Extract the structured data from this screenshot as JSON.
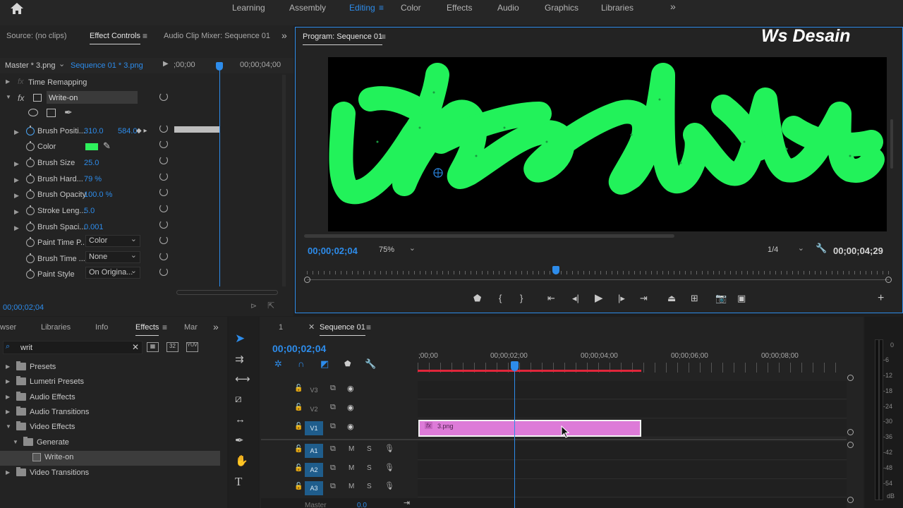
{
  "topbar": {
    "workspaces": [
      "Learning",
      "Assembly",
      "Editing",
      "Color",
      "Effects",
      "Audio",
      "Graphics",
      "Libraries"
    ],
    "active_workspace": "Editing",
    "more": "»"
  },
  "source_panel": {
    "tabs": [
      "Source: (no clips)",
      "Effect Controls",
      "Audio Clip Mixer: Sequence 01"
    ],
    "active_tab": "Effect Controls",
    "master_label": "Master * 3.png",
    "sequence_label": "Sequence 01 * 3.png",
    "ruler_start": ";00;00",
    "ruler_end": "00;00;04;00",
    "time_remapping": "Time Remapping",
    "effect_name": "Write-on",
    "fx_badge": "fx",
    "params": [
      {
        "name": "Brush Positi...",
        "value": "310.0",
        "value2": "584.0"
      },
      {
        "name": "Color",
        "value": ""
      },
      {
        "name": "Brush Size",
        "value": "25.0"
      },
      {
        "name": "Brush Hard...",
        "value": "79 %"
      },
      {
        "name": "Brush Opacity",
        "value": "100.0 %"
      },
      {
        "name": "Stroke Leng...",
        "value": "5.0"
      },
      {
        "name": "Brush Spaci...",
        "value": "0.001"
      },
      {
        "name": "Paint Time P...",
        "value": "Color"
      },
      {
        "name": "Brush Time ...",
        "value": "None"
      },
      {
        "name": "Paint Style",
        "value": "On Origina..."
      }
    ],
    "color_swatch": "#2ef05c",
    "timecode": "00;00;02;04"
  },
  "program": {
    "title": "Program: Sequence 01",
    "watermark": "Ws Desain",
    "timecode_in": "00;00;02;04",
    "zoom": "75%",
    "resolution": "1/4",
    "timecode_out": "00;00;04;29",
    "stroke_color": "#22f25a",
    "playhead_fraction": 0.43
  },
  "effects_panel": {
    "tabs": [
      "wser",
      "Libraries",
      "Info",
      "Effects",
      "Mar"
    ],
    "active_tab": "Effects",
    "search_value": "writ",
    "tree": [
      {
        "label": "Presets",
        "level": 0,
        "open": false
      },
      {
        "label": "Lumetri Presets",
        "level": 0,
        "open": false
      },
      {
        "label": "Audio Effects",
        "level": 0,
        "open": false
      },
      {
        "label": "Audio Transitions",
        "level": 0,
        "open": false
      },
      {
        "label": "Video Effects",
        "level": 0,
        "open": true
      },
      {
        "label": "Generate",
        "level": 1,
        "open": true
      },
      {
        "label": "Write-on",
        "level": 2,
        "open": false
      },
      {
        "label": "Video Transitions",
        "level": 0,
        "open": false
      }
    ]
  },
  "timeline": {
    "tabs": [
      "1",
      "Sequence 01"
    ],
    "active_tab": "Sequence 01",
    "timecode": "00;00;02;04",
    "ruler": [
      ";00;00",
      "00;00;02;00",
      "00;00;04;00",
      "00;00;06;00",
      "00;00;08;00"
    ],
    "video_tracks": [
      "V3",
      "V2",
      "V1"
    ],
    "audio_tracks": [
      "A1",
      "A2",
      "A3"
    ],
    "master_label": "Master",
    "master_value": "0.0",
    "clip_name": "3.png",
    "clip_badge": "fx",
    "clip_color": "#dd7bd8",
    "track_m": "M",
    "track_s": "S"
  },
  "meter": {
    "labels": [
      "0",
      "-6",
      "-12",
      "-18",
      "-24",
      "-30",
      "-36",
      "-42",
      "-48",
      "-54",
      "dB"
    ]
  }
}
